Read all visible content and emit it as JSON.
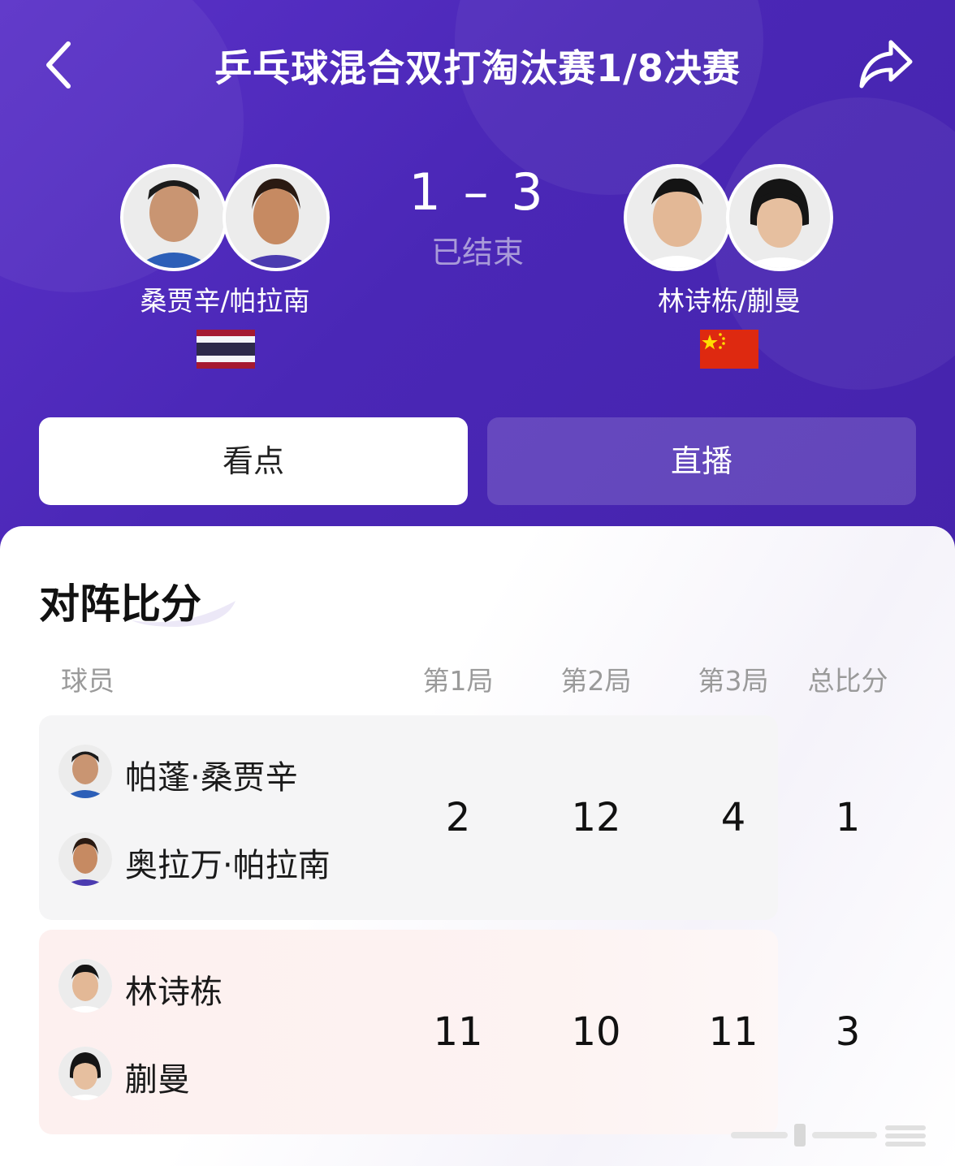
{
  "header": {
    "title": "乒乓球混合双打淘汰赛1/8决赛",
    "back_icon": "chevron-left-icon",
    "share_icon": "share-arrow-icon"
  },
  "match": {
    "score": "1 – 3",
    "status": "已结束",
    "team_left": {
      "name": "桑贾辛/帕拉南",
      "flag": "thailand-flag"
    },
    "team_right": {
      "name": "林诗栋/蒯曼",
      "flag": "china-flag"
    }
  },
  "tabs": [
    {
      "label": "看点",
      "active": true
    },
    {
      "label": "直播",
      "active": false
    }
  ],
  "scoreboard": {
    "title": "对阵比分",
    "headers": {
      "player": "球员",
      "g1": "第1局",
      "g2": "第2局",
      "g3": "第3局",
      "total": "总比分"
    },
    "rows": [
      {
        "players": [
          "帕蓬·桑贾辛",
          "奥拉万·帕拉南"
        ],
        "g1": "2",
        "g2": "12",
        "g3": "4",
        "total": "1"
      },
      {
        "players": [
          "林诗栋",
          "蒯曼"
        ],
        "g1": "11",
        "g2": "10",
        "g3": "11",
        "total": "3"
      }
    ]
  },
  "colors": {
    "hero_bg": "#4f2bbd",
    "status_text": "#a99bd9",
    "row_a_bg": "#f5f5f6",
    "row_b_bg": "#fdf0ef"
  }
}
